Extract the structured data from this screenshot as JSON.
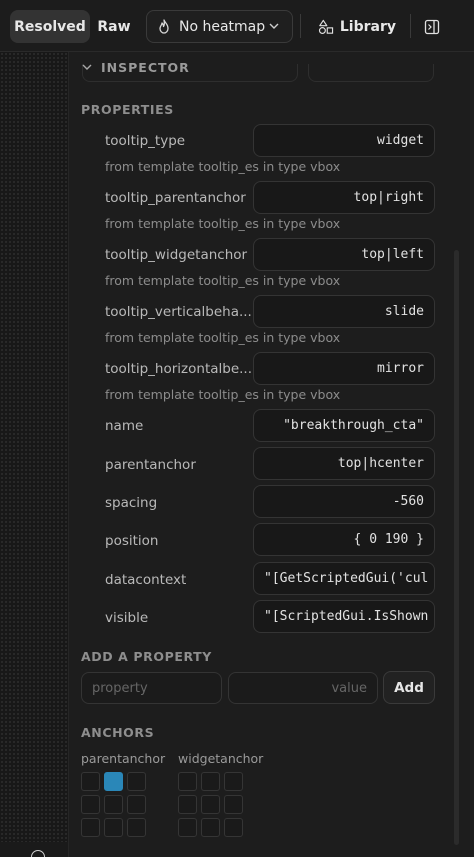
{
  "toolbar": {
    "resolved_label": "Resolved",
    "raw_label": "Raw",
    "heatmap_label": "No heatmap",
    "library_label": "Library"
  },
  "inspector": {
    "title": "INSPECTOR"
  },
  "properties": {
    "title": "PROPERTIES",
    "items": [
      {
        "name": "tooltip_type",
        "value": "widget",
        "note": "from template tooltip_es in type vbox"
      },
      {
        "name": "tooltip_parentanchor",
        "value": "top|right",
        "note": "from template tooltip_es in type vbox"
      },
      {
        "name": "tooltip_widgetanchor",
        "value": "top|left",
        "note": "from template tooltip_es in type vbox"
      },
      {
        "name": "tooltip_verticalbeha...",
        "value": "slide",
        "note": "from template tooltip_es in type vbox"
      },
      {
        "name": "tooltip_horizontalbe...",
        "value": "mirror",
        "note": "from template tooltip_es in type vbox"
      },
      {
        "name": "name",
        "value": "\"breakthrough_cta\""
      },
      {
        "name": "parentanchor",
        "value": "top|hcenter"
      },
      {
        "name": "spacing",
        "value": "-560"
      },
      {
        "name": "position",
        "value": "{ 0 190 }"
      },
      {
        "name": "datacontext",
        "value": "\"[GetScriptedGui('cul"
      },
      {
        "name": "visible",
        "value": "\"[ScriptedGui.IsShown"
      }
    ]
  },
  "add_property": {
    "title": "ADD A PROPERTY",
    "property_placeholder": "property",
    "value_placeholder": "value",
    "add_label": "Add"
  },
  "anchors": {
    "title": "ANCHORS",
    "parent_label": "parentanchor",
    "widget_label": "widgetanchor",
    "parent_selected_cell": 1,
    "accent_color": "#2a87b8"
  }
}
